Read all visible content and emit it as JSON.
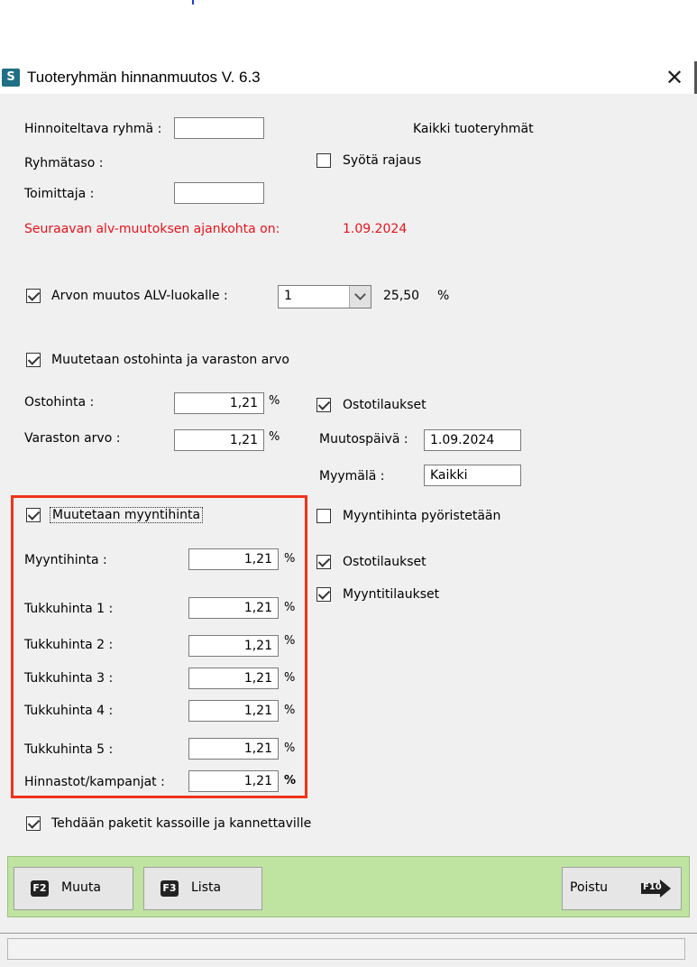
{
  "window": {
    "title": "Tuoteryhmän hinnanmuutos  V. 6.3",
    "app_icon": "S"
  },
  "top": {
    "group_label": "Hinnoiteltava ryhmä :",
    "group_value": "",
    "all_groups_text": "Kaikki tuoteryhmät",
    "level_label": "Ryhmätaso :",
    "enter_filter_label": "Syötä rajaus",
    "enter_filter_checked": false,
    "supplier_label": "Toimittaja :",
    "supplier_value": "",
    "vat_change_label": "Seuraavan alv-muutoksen ajankohta on:",
    "vat_change_date": "1.09.2024"
  },
  "vat": {
    "label": "Arvon muutos ALV-luokalle :",
    "checked": true,
    "class_value": "1",
    "rate": "25,50",
    "rate_unit": "%"
  },
  "purchase": {
    "label": "Muutetaan ostohinta ja varaston arvo",
    "checked": true,
    "purchase_price_label": "Ostohinta :",
    "purchase_price_value": "1,21",
    "stock_value_label": "Varaston arvo :",
    "stock_value_value": "1,21",
    "pct": "%",
    "purchase_orders_label": "Ostotilaukset",
    "purchase_orders_checked": true,
    "change_date_label": "Muutospäivä :",
    "change_date_value": "1.09.2024",
    "store_label": "Myymälä :",
    "store_value": "Kaikki"
  },
  "sales": {
    "label": "Muutetaan myyntihinta",
    "checked": true,
    "rows": [
      {
        "label": "Myyntihinta :",
        "value": "1,21"
      },
      {
        "label": "Tukkuhinta 1 :",
        "value": "1,21"
      },
      {
        "label": "Tukkuhinta 2 :",
        "value": "1,21"
      },
      {
        "label": "Tukkuhinta 3 :",
        "value": "1,21"
      },
      {
        "label": "Tukkuhinta 4 :",
        "value": "1,21"
      },
      {
        "label": "Tukkuhinta 5 :",
        "value": "1,21"
      },
      {
        "label": "Hinnastot/kampanjat :",
        "value": "1,21"
      }
    ],
    "pct": "%",
    "round_label": "Myyntihinta pyöristetään",
    "round_checked": false,
    "purchase_orders_label": "Ostotilaukset",
    "purchase_orders_checked": true,
    "sales_orders_label": "Myyntitilaukset",
    "sales_orders_checked": true
  },
  "packages": {
    "label": "Tehdään paketit kassoille ja kannettaville",
    "checked": true
  },
  "footer": {
    "change_key": "F2",
    "change_label": "Muuta",
    "list_key": "F3",
    "list_label": "Lista",
    "exit_label": "Poistu",
    "exit_key": "F10"
  },
  "colors": {
    "accent_red": "#e8131b",
    "highlight_box": "#f0331a",
    "footer_green": "#bfe3a0"
  },
  "icons": [
    "app-icon",
    "close-icon",
    "checkbox-icon",
    "dropdown-arrow-icon",
    "exit-arrow-icon"
  ]
}
